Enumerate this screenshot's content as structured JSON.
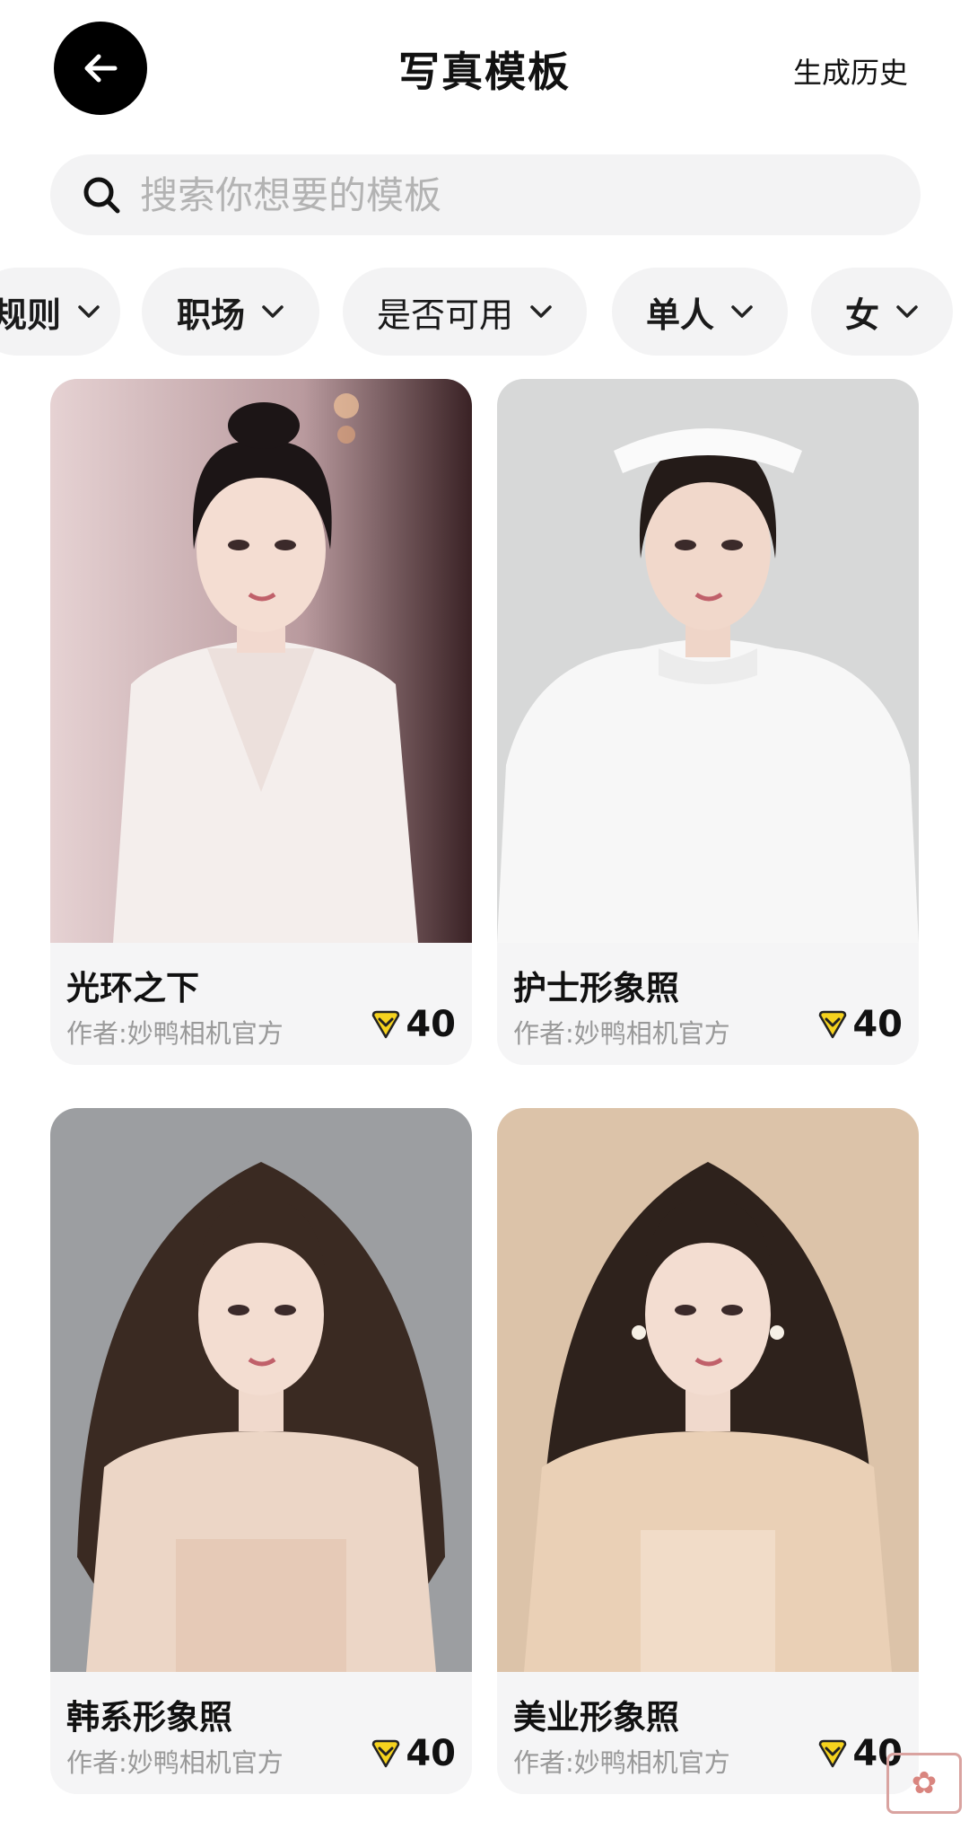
{
  "header": {
    "title": "写真模板",
    "history_label": "生成历史"
  },
  "search": {
    "placeholder": "搜索你想要的模板"
  },
  "filters": [
    {
      "label": "规则"
    },
    {
      "label": "职场"
    },
    {
      "label": "是否可用"
    },
    {
      "label": "单人"
    },
    {
      "label": "女"
    }
  ],
  "templates": [
    {
      "name": "光环之下",
      "author": "作者:妙鸭相机官方",
      "price": "40"
    },
    {
      "name": "护士形象照",
      "author": "作者:妙鸭相机官方",
      "price": "40"
    },
    {
      "name": "韩系形象照",
      "author": "作者:妙鸭相机官方",
      "price": "40"
    },
    {
      "name": "美业形象照",
      "author": "作者:妙鸭相机官方",
      "price": "40"
    }
  ],
  "icons": {
    "back": "arrow-left-icon",
    "search": "search-icon",
    "chevron": "chevron-down-icon",
    "currency": "yellow-heart-coin-icon"
  },
  "colors": {
    "accent_yellow": "#F5D21E",
    "chip_bg": "#F3F3F4",
    "placeholder": "#B3B3B3"
  }
}
